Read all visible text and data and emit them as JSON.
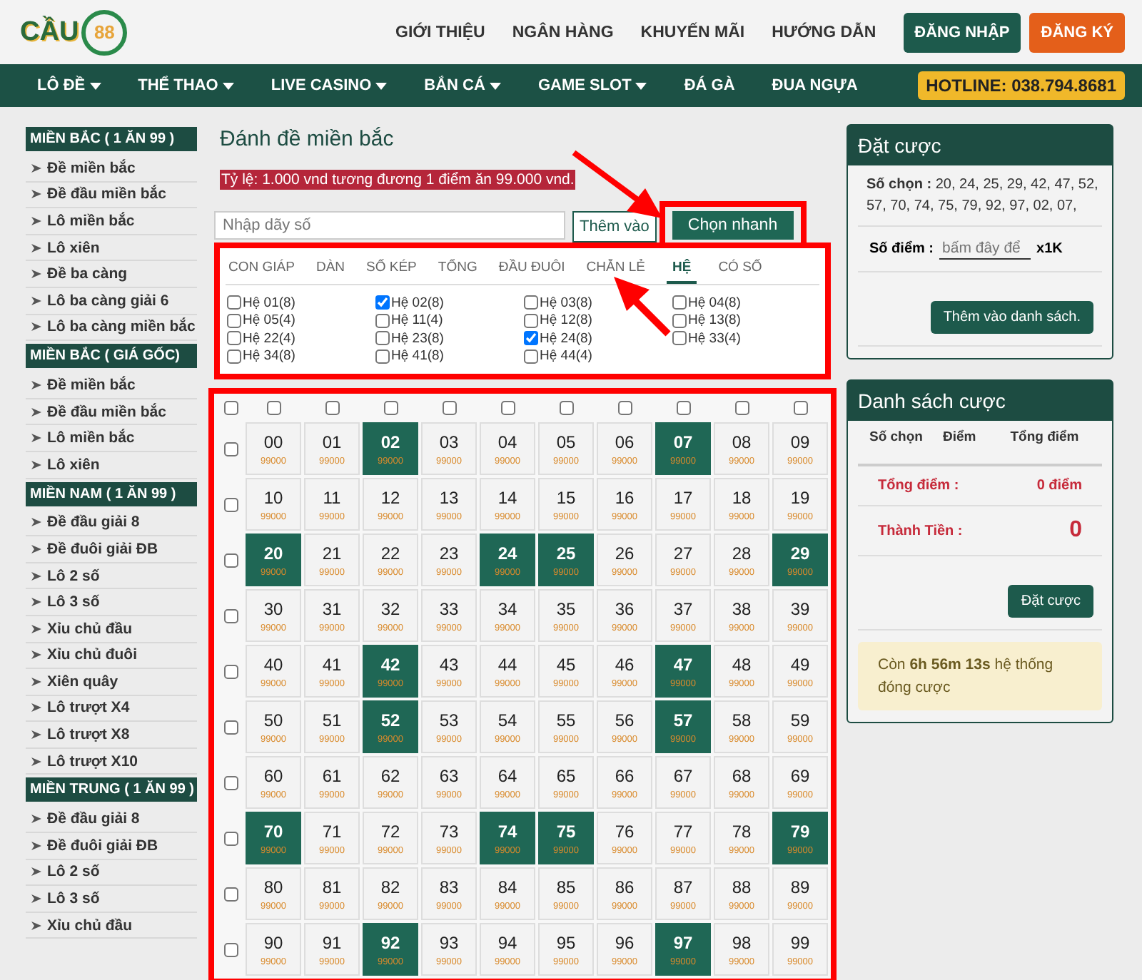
{
  "header": {
    "logo": {
      "text": "CẦU",
      "badge": "88"
    },
    "links": [
      "GIỚI THIỆU",
      "NGÂN HÀNG",
      "KHUYẾN MÃI",
      "HƯỚNG DẪN"
    ],
    "buttons": [
      {
        "label": "ĐĂNG NHẬP",
        "kind": "primary"
      },
      {
        "label": "ĐĂNG KÝ",
        "kind": "accent"
      }
    ]
  },
  "nav": {
    "items": [
      {
        "label": "LÔ ĐỀ",
        "has_dropdown": true
      },
      {
        "label": "THỂ THAO",
        "has_dropdown": true
      },
      {
        "label": "LIVE CASINO",
        "has_dropdown": true
      },
      {
        "label": "BẮN CÁ",
        "has_dropdown": true
      },
      {
        "label": "GAME SLOT",
        "has_dropdown": true
      },
      {
        "label": "ĐÁ GÀ",
        "has_dropdown": false
      },
      {
        "label": "ĐUA NGỰA",
        "has_dropdown": false
      }
    ],
    "hotline": "HOTLINE: 038.794.8681"
  },
  "sidebar": {
    "sections": [
      {
        "title": "MIỀN BẮC ( 1 ĂN 99 )",
        "items": [
          "Đề miền bắc",
          "Đề đầu miền bắc",
          "Lô miền bắc",
          "Lô xiên",
          "Đề ba càng",
          "Lô ba càng giải 6",
          "Lô ba càng miền bắc"
        ]
      },
      {
        "title": "MIỀN BẮC ( GIÁ GỐC)",
        "items": [
          "Đề miền bắc",
          "Đề đầu miền bắc",
          "Lô miền bắc",
          "Lô xiên"
        ]
      },
      {
        "title": "MIỀN NAM ( 1 ĂN 99 )",
        "items": [
          "Đề đầu giải 8",
          "Đề đuôi giải ĐB",
          "Lô 2 số",
          "Lô 3 số",
          "Xỉu chủ đầu",
          "Xỉu chủ đuôi",
          "Xiên quây",
          "Lô trượt X4",
          "Lô trượt X8",
          "Lô trượt X10"
        ]
      },
      {
        "title": "MIỀN TRUNG ( 1 ĂN 99 )",
        "items": [
          "Đề đầu giải 8",
          "Đề đuôi giải ĐB",
          "Lô 2 số",
          "Lô 3 số",
          "Xỉu chủ đầu"
        ]
      }
    ]
  },
  "main": {
    "title": "Đánh đề miền bắc",
    "rate": "Tỷ lệ: 1.000 vnd tương đương 1 điểm ăn 99.000 vnd.",
    "input": {
      "placeholder": "Nhập dãy số"
    },
    "add_button": "Thêm vào",
    "quick_button": "Chọn nhanh",
    "tabs": [
      {
        "label": "CON GIÁP",
        "selected": false
      },
      {
        "label": "DÀN",
        "selected": false
      },
      {
        "label": "SỐ KÉP",
        "selected": false
      },
      {
        "label": "TỔNG",
        "selected": false
      },
      {
        "label": "ĐẦU ĐUÔI",
        "selected": false
      },
      {
        "label": "CHẴN LẺ",
        "selected": false
      },
      {
        "label": "HỆ",
        "selected": true
      },
      {
        "label": "CÓ SỐ",
        "selected": false
      }
    ],
    "options": [
      {
        "label": "Hệ 01(8)",
        "checked": false
      },
      {
        "label": "Hệ 02(8)",
        "checked": true
      },
      {
        "label": "Hệ 03(8)",
        "checked": false
      },
      {
        "label": "Hệ 04(8)",
        "checked": false
      },
      {
        "label": "Hệ 05(4)",
        "checked": false
      },
      {
        "label": "Hệ 11(4)",
        "checked": false
      },
      {
        "label": "Hệ 12(8)",
        "checked": false
      },
      {
        "label": "Hệ 13(8)",
        "checked": false
      },
      {
        "label": "Hệ 22(4)",
        "checked": false
      },
      {
        "label": "Hệ 23(8)",
        "checked": false
      },
      {
        "label": "Hệ 24(8)",
        "checked": true
      },
      {
        "label": "Hệ 33(4)",
        "checked": false
      },
      {
        "label": "Hệ 34(8)",
        "checked": false
      },
      {
        "label": "Hệ 41(8)",
        "checked": false
      },
      {
        "label": "Hệ 44(4)",
        "checked": false
      }
    ],
    "grid": {
      "column_selectors": [
        {
          "checked": false
        },
        {
          "checked": false
        },
        {
          "checked": false
        },
        {
          "checked": false
        },
        {
          "checked": false
        },
        {
          "checked": false
        },
        {
          "checked": false
        },
        {
          "checked": false
        },
        {
          "checked": false
        },
        {
          "checked": false
        },
        {
          "checked": false
        }
      ],
      "rows": [
        {
          "checked": false,
          "cells": [
            {
              "number": "00",
              "value": "99000",
              "selected": false
            },
            {
              "number": "01",
              "value": "99000",
              "selected": false
            },
            {
              "number": "02",
              "value": "99000",
              "selected": true
            },
            {
              "number": "03",
              "value": "99000",
              "selected": false
            },
            {
              "number": "04",
              "value": "99000",
              "selected": false
            },
            {
              "number": "05",
              "value": "99000",
              "selected": false
            },
            {
              "number": "06",
              "value": "99000",
              "selected": false
            },
            {
              "number": "07",
              "value": "99000",
              "selected": true
            },
            {
              "number": "08",
              "value": "99000",
              "selected": false
            },
            {
              "number": "09",
              "value": "99000",
              "selected": false
            }
          ]
        },
        {
          "checked": false,
          "cells": [
            {
              "number": "10",
              "value": "99000",
              "selected": false
            },
            {
              "number": "11",
              "value": "99000",
              "selected": false
            },
            {
              "number": "12",
              "value": "99000",
              "selected": false
            },
            {
              "number": "13",
              "value": "99000",
              "selected": false
            },
            {
              "number": "14",
              "value": "99000",
              "selected": false
            },
            {
              "number": "15",
              "value": "99000",
              "selected": false
            },
            {
              "number": "16",
              "value": "99000",
              "selected": false
            },
            {
              "number": "17",
              "value": "99000",
              "selected": false
            },
            {
              "number": "18",
              "value": "99000",
              "selected": false
            },
            {
              "number": "19",
              "value": "99000",
              "selected": false
            }
          ]
        },
        {
          "checked": false,
          "cells": [
            {
              "number": "20",
              "value": "99000",
              "selected": true
            },
            {
              "number": "21",
              "value": "99000",
              "selected": false
            },
            {
              "number": "22",
              "value": "99000",
              "selected": false
            },
            {
              "number": "23",
              "value": "99000",
              "selected": false
            },
            {
              "number": "24",
              "value": "99000",
              "selected": true
            },
            {
              "number": "25",
              "value": "99000",
              "selected": true
            },
            {
              "number": "26",
              "value": "99000",
              "selected": false
            },
            {
              "number": "27",
              "value": "99000",
              "selected": false
            },
            {
              "number": "28",
              "value": "99000",
              "selected": false
            },
            {
              "number": "29",
              "value": "99000",
              "selected": true
            }
          ]
        },
        {
          "checked": false,
          "cells": [
            {
              "number": "30",
              "value": "99000",
              "selected": false
            },
            {
              "number": "31",
              "value": "99000",
              "selected": false
            },
            {
              "number": "32",
              "value": "99000",
              "selected": false
            },
            {
              "number": "33",
              "value": "99000",
              "selected": false
            },
            {
              "number": "34",
              "value": "99000",
              "selected": false
            },
            {
              "number": "35",
              "value": "99000",
              "selected": false
            },
            {
              "number": "36",
              "value": "99000",
              "selected": false
            },
            {
              "number": "37",
              "value": "99000",
              "selected": false
            },
            {
              "number": "38",
              "value": "99000",
              "selected": false
            },
            {
              "number": "39",
              "value": "99000",
              "selected": false
            }
          ]
        },
        {
          "checked": false,
          "cells": [
            {
              "number": "40",
              "value": "99000",
              "selected": false
            },
            {
              "number": "41",
              "value": "99000",
              "selected": false
            },
            {
              "number": "42",
              "value": "99000",
              "selected": true
            },
            {
              "number": "43",
              "value": "99000",
              "selected": false
            },
            {
              "number": "44",
              "value": "99000",
              "selected": false
            },
            {
              "number": "45",
              "value": "99000",
              "selected": false
            },
            {
              "number": "46",
              "value": "99000",
              "selected": false
            },
            {
              "number": "47",
              "value": "99000",
              "selected": true
            },
            {
              "number": "48",
              "value": "99000",
              "selected": false
            },
            {
              "number": "49",
              "value": "99000",
              "selected": false
            }
          ]
        },
        {
          "checked": false,
          "cells": [
            {
              "number": "50",
              "value": "99000",
              "selected": false
            },
            {
              "number": "51",
              "value": "99000",
              "selected": false
            },
            {
              "number": "52",
              "value": "99000",
              "selected": true
            },
            {
              "number": "53",
              "value": "99000",
              "selected": false
            },
            {
              "number": "54",
              "value": "99000",
              "selected": false
            },
            {
              "number": "55",
              "value": "99000",
              "selected": false
            },
            {
              "number": "56",
              "value": "99000",
              "selected": false
            },
            {
              "number": "57",
              "value": "99000",
              "selected": true
            },
            {
              "number": "58",
              "value": "99000",
              "selected": false
            },
            {
              "number": "59",
              "value": "99000",
              "selected": false
            }
          ]
        },
        {
          "checked": false,
          "cells": [
            {
              "number": "60",
              "value": "99000",
              "selected": false
            },
            {
              "number": "61",
              "value": "99000",
              "selected": false
            },
            {
              "number": "62",
              "value": "99000",
              "selected": false
            },
            {
              "number": "63",
              "value": "99000",
              "selected": false
            },
            {
              "number": "64",
              "value": "99000",
              "selected": false
            },
            {
              "number": "65",
              "value": "99000",
              "selected": false
            },
            {
              "number": "66",
              "value": "99000",
              "selected": false
            },
            {
              "number": "67",
              "value": "99000",
              "selected": false
            },
            {
              "number": "68",
              "value": "99000",
              "selected": false
            },
            {
              "number": "69",
              "value": "99000",
              "selected": false
            }
          ]
        },
        {
          "checked": false,
          "cells": [
            {
              "number": "70",
              "value": "99000",
              "selected": true
            },
            {
              "number": "71",
              "value": "99000",
              "selected": false
            },
            {
              "number": "72",
              "value": "99000",
              "selected": false
            },
            {
              "number": "73",
              "value": "99000",
              "selected": false
            },
            {
              "number": "74",
              "value": "99000",
              "selected": true
            },
            {
              "number": "75",
              "value": "99000",
              "selected": true
            },
            {
              "number": "76",
              "value": "99000",
              "selected": false
            },
            {
              "number": "77",
              "value": "99000",
              "selected": false
            },
            {
              "number": "78",
              "value": "99000",
              "selected": false
            },
            {
              "number": "79",
              "value": "99000",
              "selected": true
            }
          ]
        },
        {
          "checked": false,
          "cells": [
            {
              "number": "80",
              "value": "99000",
              "selected": false
            },
            {
              "number": "81",
              "value": "99000",
              "selected": false
            },
            {
              "number": "82",
              "value": "99000",
              "selected": false
            },
            {
              "number": "83",
              "value": "99000",
              "selected": false
            },
            {
              "number": "84",
              "value": "99000",
              "selected": false
            },
            {
              "number": "85",
              "value": "99000",
              "selected": false
            },
            {
              "number": "86",
              "value": "99000",
              "selected": false
            },
            {
              "number": "87",
              "value": "99000",
              "selected": false
            },
            {
              "number": "88",
              "value": "99000",
              "selected": false
            },
            {
              "number": "89",
              "value": "99000",
              "selected": false
            }
          ]
        },
        {
          "checked": false,
          "cells": [
            {
              "number": "90",
              "value": "99000",
              "selected": false
            },
            {
              "number": "91",
              "value": "99000",
              "selected": false
            },
            {
              "number": "92",
              "value": "99000",
              "selected": true
            },
            {
              "number": "93",
              "value": "99000",
              "selected": false
            },
            {
              "number": "94",
              "value": "99000",
              "selected": false
            },
            {
              "number": "95",
              "value": "99000",
              "selected": false
            },
            {
              "number": "96",
              "value": "99000",
              "selected": false
            },
            {
              "number": "97",
              "value": "99000",
              "selected": true
            },
            {
              "number": "98",
              "value": "99000",
              "selected": false
            },
            {
              "number": "99",
              "value": "99000",
              "selected": false
            }
          ]
        }
      ]
    }
  },
  "bet": {
    "title": "Đặt cược",
    "chosen": "**Số chọn :** 20, 24, 25, 29, 42, 47, 52, 57, 70, 74, 75, 79, 92, 97, 02, 07,",
    "points_label": "Số điểm :",
    "points_placeholder": "bấm đây để",
    "multiplier": "x1K",
    "add_button": "Thêm vào danh sách."
  },
  "list": {
    "title": "Danh sách cược",
    "columns": [
      "Số chọn",
      "Điểm",
      "Tổng điểm"
    ],
    "total_label": "Tổng điểm :",
    "total_value": "0 điểm",
    "amount_label": "Thành Tiền :",
    "amount_value": "0",
    "submit": "Đặt cược",
    "countdown": "Còn **6h 56m 13s** hệ thống đóng cược"
  }
}
